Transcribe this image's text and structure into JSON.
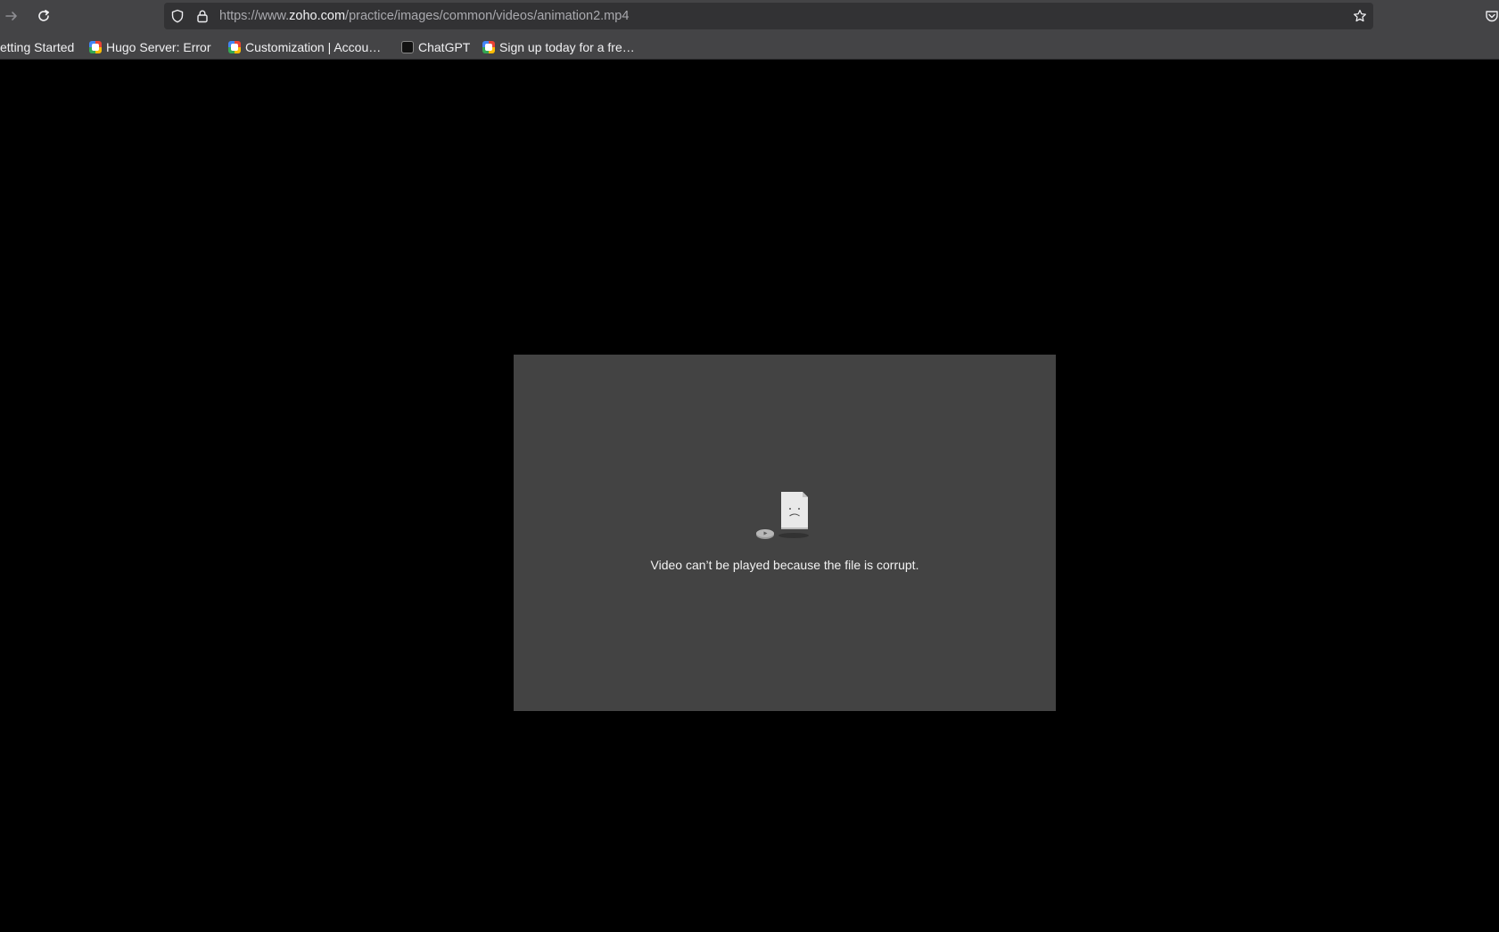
{
  "toolbar": {
    "forward_icon": "arrow-right-icon",
    "reload_icon": "reload-icon"
  },
  "urlbar": {
    "url_prefix": "https://www.",
    "url_host": "zoho.com",
    "url_path": "/practice/images/common/videos/animation2.mp4",
    "icons": [
      "shield-icon",
      "lock-icon",
      "star-icon"
    ]
  },
  "bookmarks": [
    {
      "label": "etting Started",
      "icon": "none"
    },
    {
      "label": "Hugo Server: Error",
      "icon": "multicolor-favicon"
    },
    {
      "label": "Customization | Accou…",
      "icon": "multicolor-favicon"
    },
    {
      "label": "ChatGPT",
      "icon": "chatgpt-favicon"
    },
    {
      "label": "Sign up today for a fre…",
      "icon": "multicolor-favicon"
    }
  ],
  "video": {
    "error_message": "Video can’t be played because the file is corrupt.",
    "error_icon": "corrupt-file-icon"
  },
  "colors": {
    "page_background": "#000000",
    "toolbar_background": "#444446",
    "urlbar_background": "#323234",
    "video_frame_background": "#434343"
  }
}
